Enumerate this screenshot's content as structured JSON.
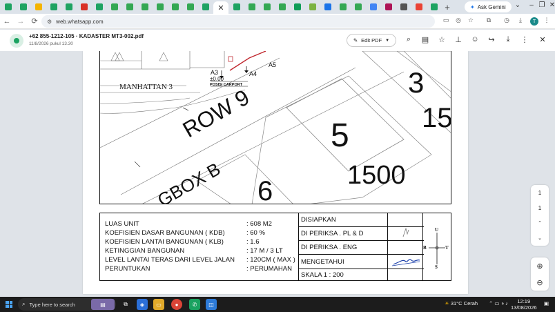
{
  "browser": {
    "tabs": [
      {
        "icon": "sheets-icon",
        "color": "#1ea362"
      },
      {
        "icon": "sheets-icon",
        "color": "#1ea362"
      },
      {
        "icon": "drive-icon",
        "color": "#f4b400"
      },
      {
        "icon": "sheets-icon",
        "color": "#1ea362"
      },
      {
        "icon": "sheets-icon",
        "color": "#1ea362"
      },
      {
        "icon": "gmail-icon",
        "color": "#d93025"
      },
      {
        "icon": "sheets-icon",
        "color": "#1ea362"
      },
      {
        "icon": "maps-icon",
        "color": "#34a853"
      },
      {
        "icon": "maps-icon",
        "color": "#34a853"
      },
      {
        "icon": "maps-icon",
        "color": "#34a853"
      },
      {
        "icon": "maps-icon",
        "color": "#34a853"
      },
      {
        "icon": "maps-icon",
        "color": "#34a853"
      },
      {
        "icon": "maps-icon",
        "color": "#34a853"
      },
      {
        "icon": "sheets-icon",
        "color": "#1ea362"
      },
      {
        "icon": "close-icon",
        "color": "#ffffff",
        "active": true
      },
      {
        "icon": "sheets-icon",
        "color": "#1ea362"
      },
      {
        "icon": "maps-icon",
        "color": "#34a853"
      },
      {
        "icon": "maps-icon",
        "color": "#34a853"
      },
      {
        "icon": "maps-icon",
        "color": "#34a853"
      },
      {
        "icon": "photos-icon",
        "color": "#0f9d58"
      },
      {
        "icon": "maps-icon",
        "color": "#7cb342"
      },
      {
        "icon": "analytics-icon",
        "color": "#1a73e8"
      },
      {
        "icon": "maps-icon",
        "color": "#34a853"
      },
      {
        "icon": "maps-icon",
        "color": "#34a853"
      },
      {
        "icon": "tasks-icon",
        "color": "#4285f4"
      },
      {
        "icon": "home-icon",
        "color": "#ad1457"
      },
      {
        "icon": "news-icon",
        "color": "#555555"
      },
      {
        "icon": "google-icon",
        "color": "#ea4335"
      },
      {
        "icon": "sheets-icon",
        "color": "#1ea362"
      }
    ],
    "new_tab": "+",
    "ask_gemini": "Ask Gemini",
    "url": "web.whatsapp.com",
    "profile_initial": "T"
  },
  "viewer": {
    "title": "+62 855-1212-105 · KADASTER MT3-002.pdf",
    "subtitle": "11/8/2026 pukul 13.30",
    "edit_label": "Edit PDF"
  },
  "plan": {
    "labels": {
      "a3": "A3",
      "elev": "±0.00",
      "a4": "A4",
      "a5": "A5",
      "carport": "POSISI CARPORT",
      "area_name": "MANHATTAN 3",
      "road": "ROW 9",
      "lot_3": "3",
      "lot_15": "15",
      "lot_5": "5",
      "dim_1500": "1500",
      "box": "GBOX B",
      "lot_6": "6"
    }
  },
  "info": {
    "rows": [
      {
        "label": "LUAS UNIT",
        "value": ": 608 M2"
      },
      {
        "label": "KOEFISIEN DASAR BANGUNAN ( KDB)",
        "value": ": 60 %"
      },
      {
        "label": "KOEFISIEN LANTAI BANGUNAN ( KLB)",
        "value": ": 1.6"
      },
      {
        "label": "KETINGGIAN BANGUNAN",
        "value": ": 17 M / 3 LT"
      },
      {
        "label": "LEVEL LANTAI TERAS DARI LEVEL JALAN",
        "value": ": 120CM ( MAX )"
      },
      {
        "label": "PERUNTUKAN",
        "value": ": PERUMAHAN"
      }
    ],
    "approvals": [
      "DISIAPKAN",
      "DI PERIKSA . PL & D",
      "DI PERIKSA . ENG",
      "MENGETAHUI",
      "SKALA 1 : 200"
    ],
    "compass": {
      "n": "U",
      "s": "S",
      "w": "B",
      "e": "T"
    }
  },
  "pager": {
    "pages": [
      "1",
      "1"
    ]
  },
  "taskbar": {
    "search_placeholder": "Type here to search",
    "weather": "31°C  Cerah",
    "time": "12:19",
    "date": "13/08/2026"
  }
}
